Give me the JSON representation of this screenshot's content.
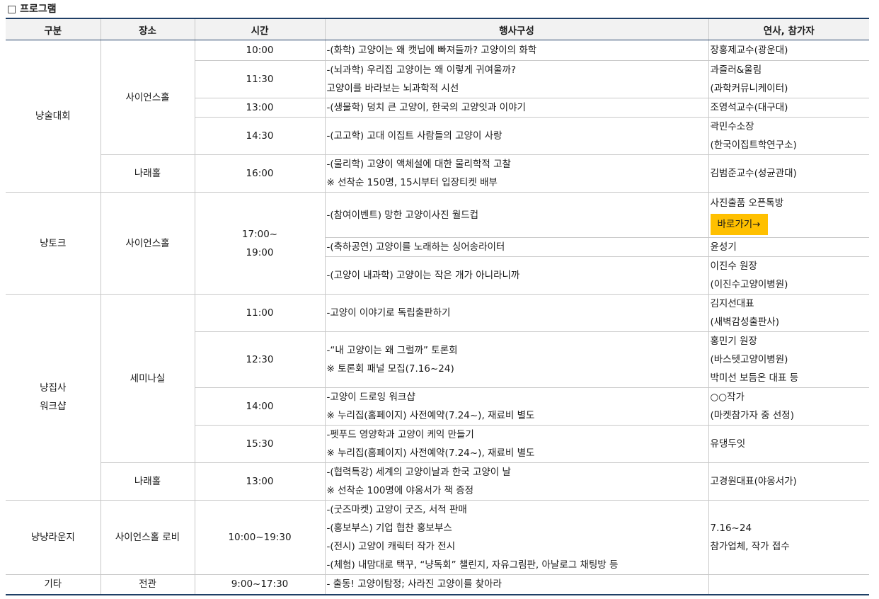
{
  "title": "□ 프로그램",
  "headers": [
    "구분",
    "장소",
    "시간",
    "행사구성",
    "연사, 참가자"
  ],
  "categories": {
    "c1": "냥술대회",
    "c2": "냥토크",
    "c3a": "냥집사",
    "c3b": "워크샵",
    "c4": "냥냥라운지",
    "c5": "기타"
  },
  "venues": {
    "v1": "사이언스홀",
    "v2": "나래홀",
    "v3": "사이언스홀",
    "v4": "세미나실",
    "v5": "나래홀",
    "v6": "사이언스홀 로비",
    "v7": "전관"
  },
  "rows": [
    {
      "time": "10:00",
      "ev1": "-(화학) 고양이는 왜 캣닙에 빠져들까? 고양이의 화학",
      "sp1": "장홍제교수(광운대)"
    },
    {
      "time": "11:30",
      "ev1": "-(뇌과학) 우리집 고양이는 왜 이렇게 귀여울까?",
      "ev2": " 고양이를 바라보는 뇌과학적 시선",
      "sp1": "과즐러&울림",
      "sp2": "(과학커뮤니케이터)"
    },
    {
      "time": "13:00",
      "ev1": "-(생물학) 덩치 큰 고양이, 한국의 고양잇과 이야기",
      "sp1": "조영석교수(대구대)"
    },
    {
      "time": "14:30",
      "ev1": "-(고고학) 고대 이집트 사람들의 고양이 사랑",
      "sp1": "곽민수소장",
      "sp2": "(한국이집트학연구소)"
    },
    {
      "time": "16:00",
      "ev1": "-(물리학) 고양이 액체설에 대한 물리학적 고찰",
      "ev2": " ※ 선착순 150명, 15시부터 입장티켓 배부",
      "sp1": "김범준교수(성균관대)"
    },
    {
      "time1": "17:00~",
      "time2": "19:00",
      "ev1": "-(참여이벤트) 망한 고양이사진 월드컵",
      "sp1": "사진출품 오픈톡방",
      "button": "바로가기→"
    },
    {
      "ev1": "-(축하공연) 고양이를 노래하는 싱어송라이터",
      "sp1": "윤성기"
    },
    {
      "ev1": "-(고양이 내과학) 고양이는 작은 개가 아니라니까",
      "sp1": "이진수 원장",
      "sp2": "(이진수고양이병원)"
    },
    {
      "time": "11:00",
      "ev1": "-고양이 이야기로 독립출판하기",
      "sp1": "김지선대표",
      "sp2": "(새벽감성출판사)"
    },
    {
      "time": "12:30",
      "ev1": "-“내 고양이는 왜 그럴까” 토론회",
      "ev2": " ※ 토론회 패널 모집(7.16~24)",
      "sp1": "홍민기 원장",
      "sp2": "(바스텟고양이병원)",
      "sp3": "박미선 보듬온 대표 등"
    },
    {
      "time": "14:00",
      "ev1": "-고양이 드로잉 워크샵",
      "ev2": " ※ 누리집(홈페이지) 사전예약(7.24~), 재료비 별도",
      "sp1": "○○작가",
      "sp2": "(마켓참가자 중 선정)"
    },
    {
      "time": "15:30",
      "ev1": "-펫푸드 영양학과 고양이 케익 만들기",
      "ev2": " ※ 누리집(홈페이지) 사전예약(7.24~), 재료비 별도",
      "sp1": "유댕두잇"
    },
    {
      "time": "13:00",
      "ev1": "-(협력특강) 세계의 고양이날과 한국 고양이 날",
      "ev2": " ※ 선착순 100명에 야옹서가 책 증정",
      "sp1": "고경원대표(야옹서가)"
    },
    {
      "time": "10:00~19:30",
      "ev1": "-(굿즈마켓) 고양이 굿즈, 서적 판매",
      "ev2": "-(홍보부스) 기업 협찬 홍보부스",
      "ev3": "-(전시) 고양이 캐릭터 작가 전시",
      "ev4": "-(체험) 내맘대로 택꾸, “냥독회” 챌린지, 자유그림판, 아날로그 채팅방 등",
      "sp1": "7.16~24",
      "sp2": "참가업체, 작가 접수"
    },
    {
      "time": "9:00~17:30",
      "ev1": "- 출동! 고양이탐정; 사라진 고양이를 찾아라",
      "sp1": ""
    }
  ]
}
